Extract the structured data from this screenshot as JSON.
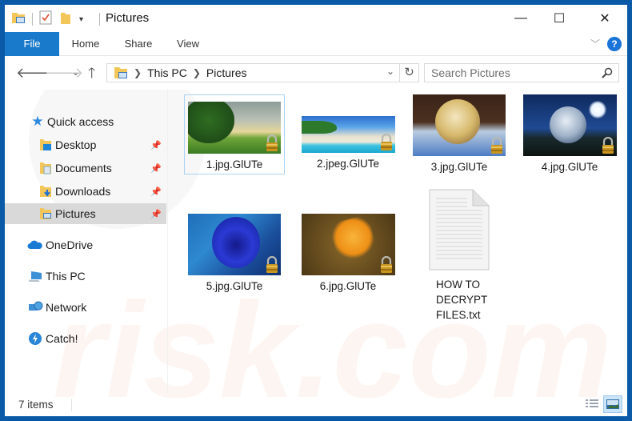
{
  "window": {
    "title": "Pictures",
    "controls": {
      "minimize": "—",
      "maximize": "☐",
      "close": "✕"
    }
  },
  "ribbon": {
    "tabs": [
      {
        "label": "File",
        "active": true
      },
      {
        "label": "Home"
      },
      {
        "label": "Share"
      },
      {
        "label": "View"
      }
    ],
    "help_label": "?"
  },
  "address": {
    "crumbs": [
      "This PC",
      "Pictures"
    ],
    "search_placeholder": "Search Pictures"
  },
  "navpane": {
    "quick_access": "Quick access",
    "pinned": [
      {
        "label": "Desktop",
        "icon": "desktop-folder-icon"
      },
      {
        "label": "Documents",
        "icon": "documents-folder-icon"
      },
      {
        "label": "Downloads",
        "icon": "downloads-folder-icon"
      },
      {
        "label": "Pictures",
        "icon": "pictures-folder-icon",
        "selected": true
      }
    ],
    "locations": [
      {
        "label": "OneDrive",
        "icon": "onedrive-icon"
      },
      {
        "label": "This PC",
        "icon": "this-pc-icon"
      },
      {
        "label": "Network",
        "icon": "network-icon"
      },
      {
        "label": "Catch!",
        "icon": "catch-icon"
      }
    ]
  },
  "files": [
    {
      "name": "1.jpg.GlUTe",
      "locked": true,
      "selected": true
    },
    {
      "name": "2.jpeg.GlUTe",
      "locked": true
    },
    {
      "name": "3.jpg.GlUTe",
      "locked": true
    },
    {
      "name": "4.jpg.GlUTe",
      "locked": true
    },
    {
      "name": "5.jpg.GlUTe",
      "locked": true
    },
    {
      "name": "6.jpg.GlUTe",
      "locked": true
    },
    {
      "name": "HOW TO DECRYPT FILES.txt",
      "name_lines": [
        "HOW TO",
        "DECRYPT",
        "FILES.txt"
      ],
      "locked": false
    }
  ],
  "status": {
    "item_count": "7 items"
  },
  "colors": {
    "accent": "#1979ca",
    "frame": "#0a5aa8",
    "selection": "#d9d9d9"
  }
}
